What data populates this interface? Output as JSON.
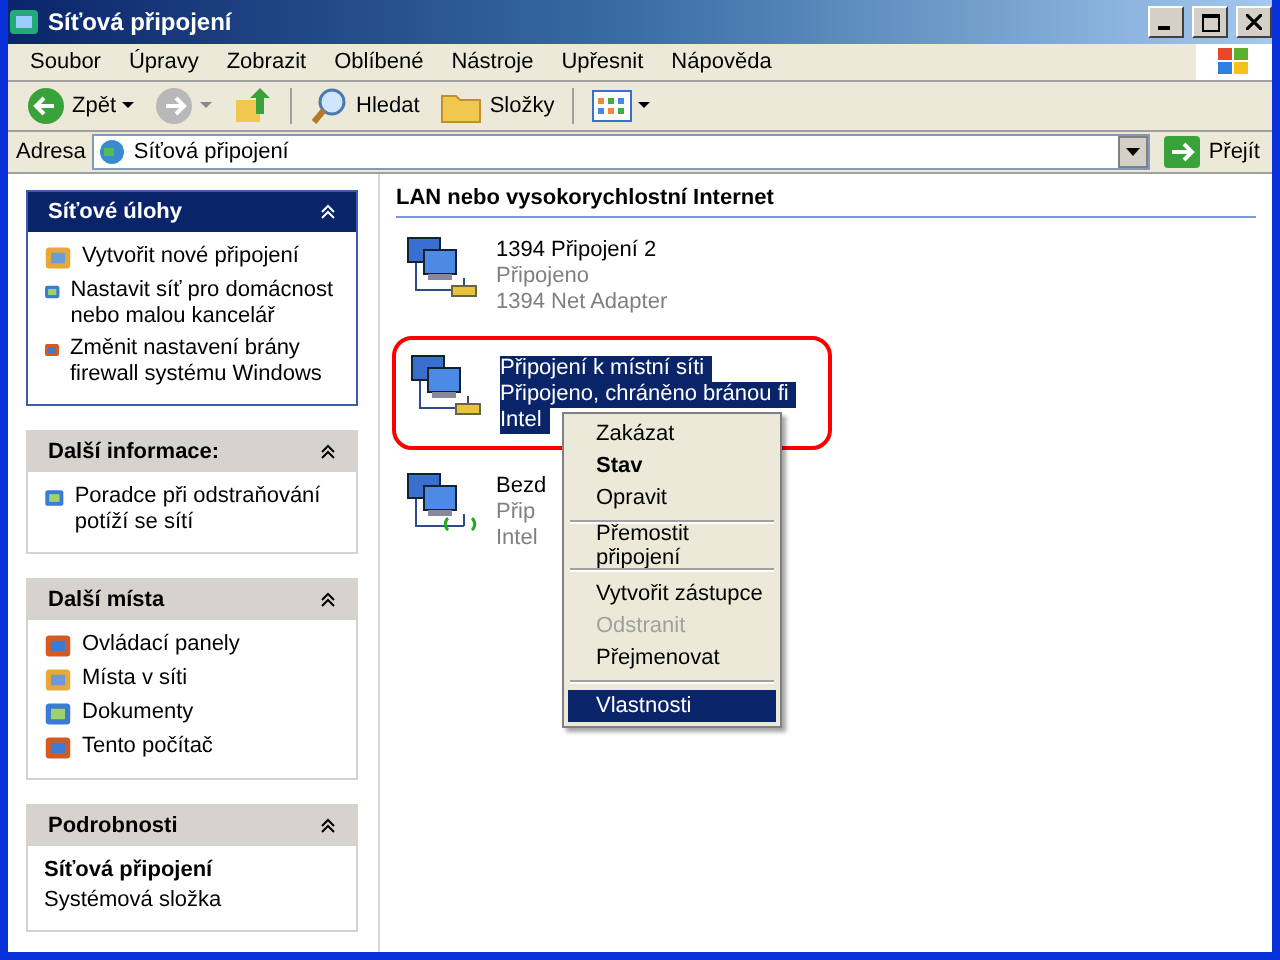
{
  "window": {
    "title": "Síťová připojení"
  },
  "menu_bar": [
    "Soubor",
    "Úpravy",
    "Zobrazit",
    "Oblíbené",
    "Nástroje",
    "Upřesnit",
    "Nápověda"
  ],
  "toolbar": {
    "back": "Zpět",
    "search": "Hledat",
    "folders": "Složky"
  },
  "address": {
    "label": "Adresa",
    "value": "Síťová připojení",
    "go": "Přejít"
  },
  "sidebar": [
    {
      "kind": "primary",
      "title": "Síťové úlohy",
      "items": [
        "Vytvořit nové připojení",
        "Nastavit síť pro domácnost nebo malou kancelář",
        "Změnit nastavení brány firewall systému Windows"
      ]
    },
    {
      "kind": "normal",
      "title": "Další informace:",
      "items": [
        "Poradce při odstraňování potíží se sítí"
      ]
    },
    {
      "kind": "normal",
      "title": "Další místa",
      "items": [
        "Ovládací panely",
        "Místa v síti",
        "Dokumenty",
        "Tento počítač"
      ]
    },
    {
      "kind": "details",
      "title": "Podrobnosti",
      "name": "Síťová připojení",
      "subtitle": "Systémová složka"
    }
  ],
  "content": {
    "group_title": "LAN nebo vysokorychlostní Internet",
    "connections": [
      {
        "kind": "wired",
        "name": "1394 Připojení 2",
        "status": "Připojeno",
        "adapter": "1394 Net Adapter",
        "selected": false
      },
      {
        "kind": "wired",
        "name": "Připojení k místní síti",
        "status": "Připojeno, chráněno bránou fi",
        "adapter": "Intel",
        "selected": true
      },
      {
        "kind": "wireless",
        "name": "Bezd",
        "status": "Přip",
        "adapter": "Intel",
        "selected": false
      }
    ]
  },
  "context_menu": [
    {
      "kind": "item",
      "label": "Zakázat",
      "bold": false,
      "disabled": false,
      "selected": false
    },
    {
      "kind": "item",
      "label": "Stav",
      "bold": true,
      "disabled": false,
      "selected": false
    },
    {
      "kind": "item",
      "label": "Opravit",
      "bold": false,
      "disabled": false,
      "selected": false
    },
    {
      "kind": "separator"
    },
    {
      "kind": "item",
      "label": "Přemostit připojení",
      "bold": false,
      "disabled": false,
      "selected": false
    },
    {
      "kind": "separator"
    },
    {
      "kind": "item",
      "label": "Vytvořit zástupce",
      "bold": false,
      "disabled": false,
      "selected": false
    },
    {
      "kind": "item",
      "label": "Odstranit",
      "bold": false,
      "disabled": true,
      "selected": false
    },
    {
      "kind": "item",
      "label": "Přejmenovat",
      "bold": false,
      "disabled": false,
      "selected": false
    },
    {
      "kind": "separator"
    },
    {
      "kind": "item",
      "label": "Vlastnosti",
      "bold": false,
      "disabled": false,
      "selected": true
    }
  ]
}
